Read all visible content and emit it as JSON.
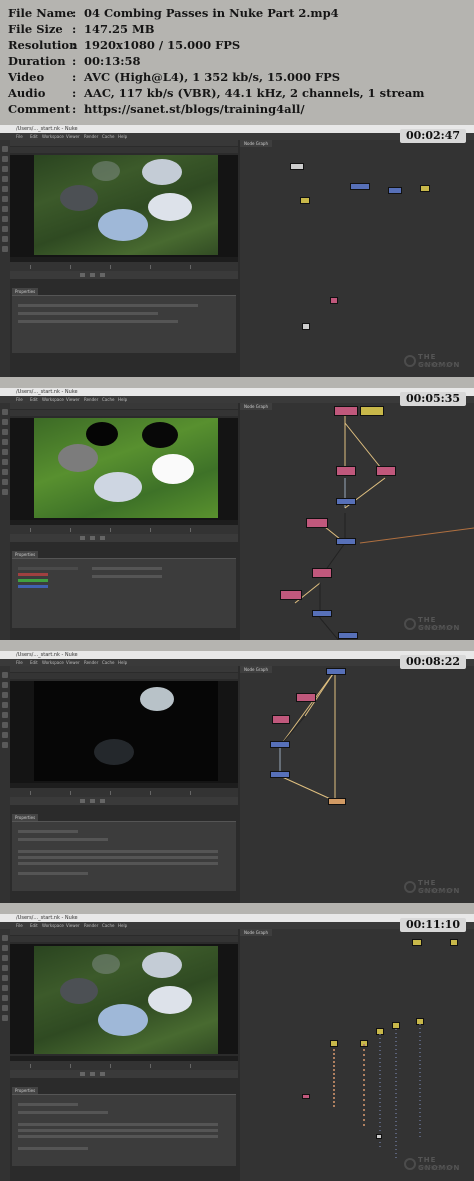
{
  "header": {
    "rows": [
      {
        "key": "File Name",
        "value": "04 Combing Passes in Nuke Part 2.mp4"
      },
      {
        "key": "File Size",
        "value": "147.25 MB"
      },
      {
        "key": "Resolution",
        "value": "1920x1080 / 15.000 FPS"
      },
      {
        "key": "Duration",
        "value": "00:13:58"
      },
      {
        "key": "Video",
        "value": "AVC (High@L4), 1 352 kb/s, 15.000 FPS"
      },
      {
        "key": "Audio",
        "value": "AAC, 117 kb/s (VBR), 44.1 kHz, 2 channels, 1 stream"
      },
      {
        "key": "Comment",
        "value": "https://sanet.st/blogs/training4all/"
      }
    ],
    "separator": ":"
  },
  "app": {
    "menu": [
      "File",
      "Edit",
      "Workspace",
      "Viewer",
      "Render",
      "Cache",
      "Help"
    ],
    "node_graph_tab": "Node Graph",
    "properties_tab": "Properties"
  },
  "frames": [
    {
      "timestamp": "00:02:47",
      "title": "/Users/..._start.nk - Nuke",
      "image": "teapots-grass"
    },
    {
      "timestamp": "00:05:35",
      "title": "/Users/..._start.nk - Nuke",
      "image": "teapots-mattes"
    },
    {
      "timestamp": "00:08:22",
      "title": "/Users/..._start.nk - Nuke",
      "image": "teapots-dark"
    },
    {
      "timestamp": "00:11:10",
      "title": "/Users/..._start.nk - Nuke",
      "image": "teapots-grass"
    }
  ],
  "watermark": {
    "line1": "THE GNOMON",
    "line2": "WORKSHOP"
  }
}
